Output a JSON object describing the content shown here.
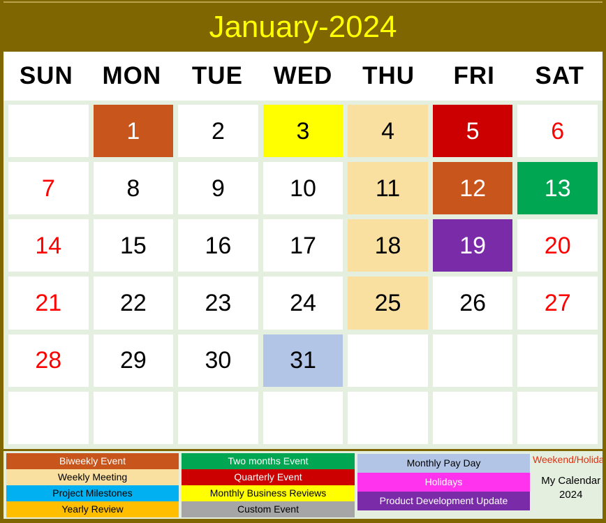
{
  "header": {
    "title": "January-2024",
    "title_color": "#ffff00",
    "bar_color": "#806600"
  },
  "weekdays": [
    "SUN",
    "MON",
    "TUE",
    "WED",
    "THU",
    "FRI",
    "SAT"
  ],
  "calendar": {
    "month": "January",
    "year": "2024",
    "weeks": [
      [
        {
          "day": "",
          "bg": "#ffffff",
          "fg": "#000000"
        },
        {
          "day": "1",
          "bg": "#c8551b",
          "fg": "#ffffff"
        },
        {
          "day": "2",
          "bg": "#ffffff",
          "fg": "#000000"
        },
        {
          "day": "3",
          "bg": "#ffff00",
          "fg": "#000000"
        },
        {
          "day": "4",
          "bg": "#fae0a0",
          "fg": "#000000"
        },
        {
          "day": "5",
          "bg": "#cc0000",
          "fg": "#ffffff"
        },
        {
          "day": "6",
          "bg": "#ffffff",
          "fg": "#ff0000"
        }
      ],
      [
        {
          "day": "7",
          "bg": "#ffffff",
          "fg": "#ff0000"
        },
        {
          "day": "8",
          "bg": "#ffffff",
          "fg": "#000000"
        },
        {
          "day": "9",
          "bg": "#ffffff",
          "fg": "#000000"
        },
        {
          "day": "10",
          "bg": "#ffffff",
          "fg": "#000000"
        },
        {
          "day": "11",
          "bg": "#fae0a0",
          "fg": "#000000"
        },
        {
          "day": "12",
          "bg": "#c8551b",
          "fg": "#ffffff"
        },
        {
          "day": "13",
          "bg": "#00a651",
          "fg": "#ffffff"
        }
      ],
      [
        {
          "day": "14",
          "bg": "#ffffff",
          "fg": "#ff0000"
        },
        {
          "day": "15",
          "bg": "#ffffff",
          "fg": "#000000"
        },
        {
          "day": "16",
          "bg": "#ffffff",
          "fg": "#000000"
        },
        {
          "day": "17",
          "bg": "#ffffff",
          "fg": "#000000"
        },
        {
          "day": "18",
          "bg": "#fae0a0",
          "fg": "#000000"
        },
        {
          "day": "19",
          "bg": "#7a2ca8",
          "fg": "#ffffff"
        },
        {
          "day": "20",
          "bg": "#ffffff",
          "fg": "#ff0000"
        }
      ],
      [
        {
          "day": "21",
          "bg": "#ffffff",
          "fg": "#ff0000"
        },
        {
          "day": "22",
          "bg": "#ffffff",
          "fg": "#000000"
        },
        {
          "day": "23",
          "bg": "#ffffff",
          "fg": "#000000"
        },
        {
          "day": "24",
          "bg": "#ffffff",
          "fg": "#000000"
        },
        {
          "day": "25",
          "bg": "#fae0a0",
          "fg": "#000000"
        },
        {
          "day": "26",
          "bg": "#ffffff",
          "fg": "#000000"
        },
        {
          "day": "27",
          "bg": "#ffffff",
          "fg": "#ff0000"
        }
      ],
      [
        {
          "day": "28",
          "bg": "#ffffff",
          "fg": "#ff0000"
        },
        {
          "day": "29",
          "bg": "#ffffff",
          "fg": "#000000"
        },
        {
          "day": "30",
          "bg": "#ffffff",
          "fg": "#000000"
        },
        {
          "day": "31",
          "bg": "#b3c5e7",
          "fg": "#000000"
        },
        {
          "day": "",
          "bg": "#ffffff",
          "fg": "#000000"
        },
        {
          "day": "",
          "bg": "#ffffff",
          "fg": "#000000"
        },
        {
          "day": "",
          "bg": "#ffffff",
          "fg": "#000000"
        }
      ],
      [
        {
          "day": "",
          "bg": "#ffffff",
          "fg": "#000000"
        },
        {
          "day": "",
          "bg": "#ffffff",
          "fg": "#000000"
        },
        {
          "day": "",
          "bg": "#ffffff",
          "fg": "#000000"
        },
        {
          "day": "",
          "bg": "#ffffff",
          "fg": "#000000"
        },
        {
          "day": "",
          "bg": "#ffffff",
          "fg": "#000000"
        },
        {
          "day": "",
          "bg": "#ffffff",
          "fg": "#000000"
        },
        {
          "day": "",
          "bg": "#ffffff",
          "fg": "#000000"
        }
      ]
    ]
  },
  "legend": {
    "column1": [
      {
        "label": "Biweekly Event",
        "bg": "#c8551b",
        "fg": "#ffffff"
      },
      {
        "label": "Weekly Meeting",
        "bg": "#fae0a0",
        "fg": "#000000"
      },
      {
        "label": "Project Milestones",
        "bg": "#00b0f0",
        "fg": "#000000"
      },
      {
        "label": "Yearly Review",
        "bg": "#ffbf00",
        "fg": "#000000"
      }
    ],
    "column2": [
      {
        "label": "Two months Event",
        "bg": "#00a651",
        "fg": "#ffffff"
      },
      {
        "label": "Quarterly Event",
        "bg": "#cc0000",
        "fg": "#ffffff"
      },
      {
        "label": "Monthly Business Reviews",
        "bg": "#ffff00",
        "fg": "#000000"
      },
      {
        "label": "Custom Event",
        "bg": "#a6a6a6",
        "fg": "#000000"
      }
    ],
    "column3": [
      {
        "label": "Monthly Pay Day",
        "bg": "#b3c5e7",
        "fg": "#000000"
      },
      {
        "label": "Holidays",
        "bg": "#ff33ee",
        "fg": "#ffffff"
      },
      {
        "label": "Product Development Update",
        "bg": "#7a2ca8",
        "fg": "#ffffff"
      }
    ],
    "column4": {
      "weekend_note": "Weekend/Holiday",
      "weekend_note_color": "#e03010",
      "calendar_name": "My Calendar",
      "calendar_year": "2024"
    }
  }
}
